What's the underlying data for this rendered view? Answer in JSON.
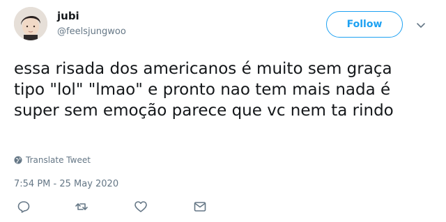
{
  "user": {
    "name": "jubi",
    "handle": "@feelsjungwoo"
  },
  "header": {
    "follow_label": "Follow"
  },
  "tweet": {
    "text": "essa risada dos americanos é muito sem graça tipo \"lol\" \"lmao\" e pronto nao tem mais nada é super sem emoção parece que vc nem ta rindo",
    "translate_label": "Translate Tweet",
    "timestamp": "7:54 PM - 25 May 2020"
  },
  "icons": {
    "caret": "chevron-down-icon",
    "translate": "globe-icon",
    "reply": "reply-icon",
    "retweet": "retweet-icon",
    "like": "heart-icon",
    "dm": "envelope-icon"
  },
  "colors": {
    "accent": "#1da1f2",
    "text": "#14171a",
    "secondary": "#657786"
  }
}
